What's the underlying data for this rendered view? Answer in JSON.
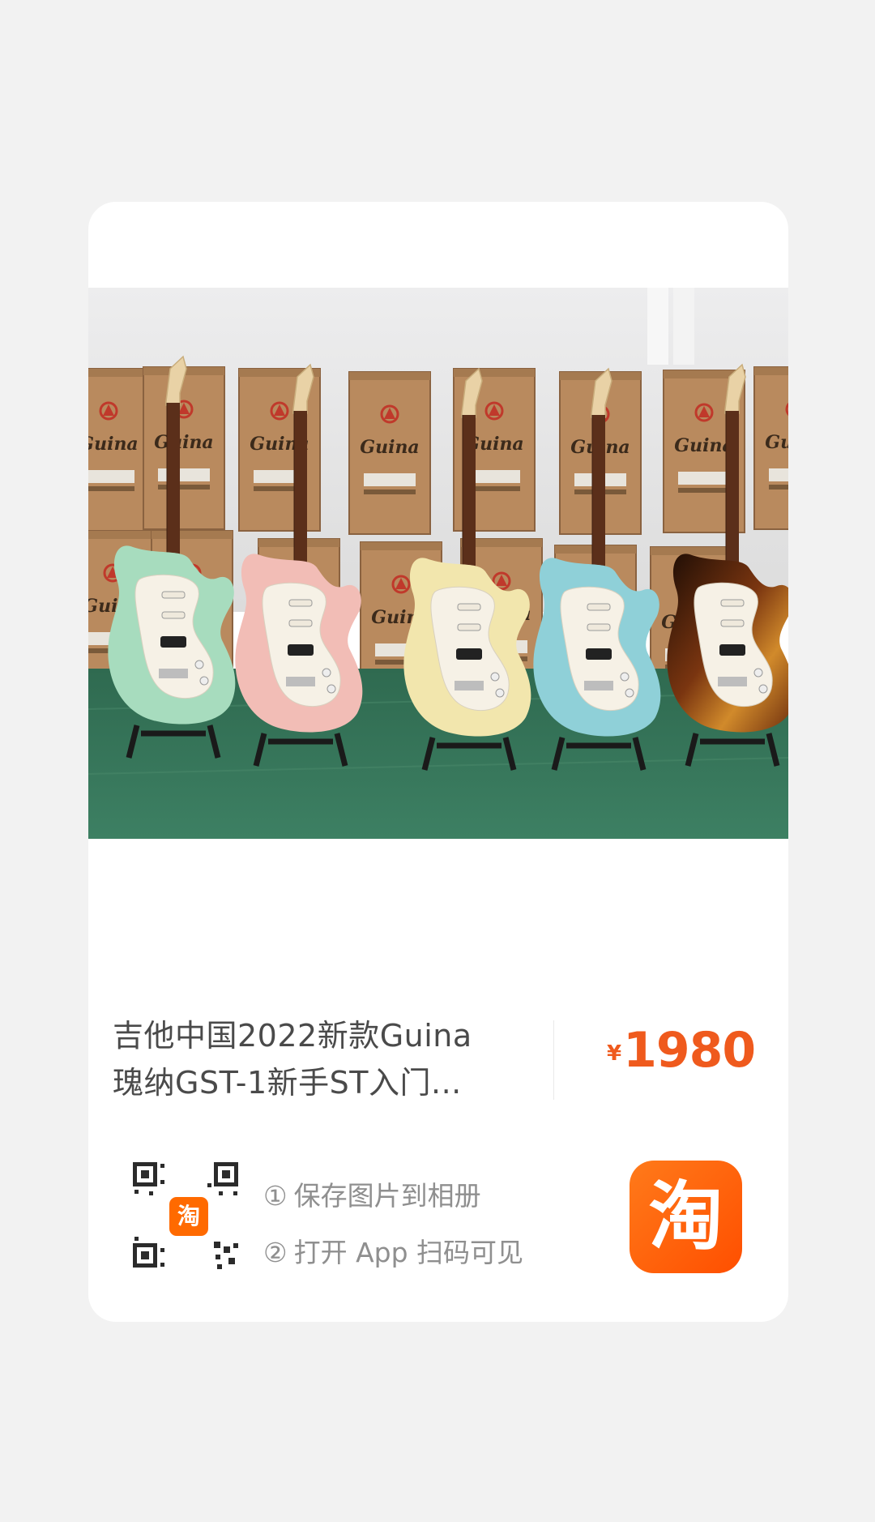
{
  "product": {
    "title_line1": "吉他中国2022新款Guina",
    "title_line2": "瑰纳GST-1新手ST入门...",
    "price_symbol": "¥",
    "price": "1980",
    "photo_brand_text": "Guina"
  },
  "share": {
    "step1_num": "①",
    "step1_text": "保存图片到相册",
    "step2_num": "②",
    "step2_text": "打开 App 扫码可见",
    "qr_center_badge": "淘",
    "app_icon_text": "淘"
  },
  "colors": {
    "accent": "#ef5a1d",
    "badge_orange": "#ff6a00",
    "text_gray": "#4a4a4a",
    "hint_gray": "#8f8f8f"
  },
  "guitar_colors": [
    "#a7dcbe",
    "#f2bdb6",
    "#f2e6ad",
    "#8fd0d8",
    "#5a2a0f"
  ]
}
